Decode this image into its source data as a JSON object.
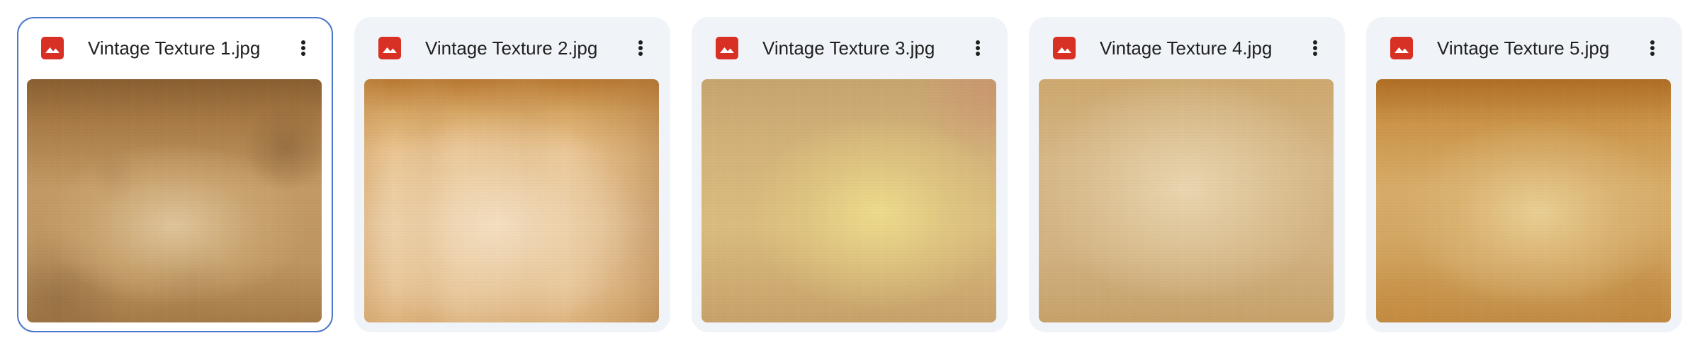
{
  "files": [
    {
      "name": "Vintage Texture 1.jpg",
      "type_icon": "image-file-icon",
      "selected": true
    },
    {
      "name": "Vintage Texture 2.jpg",
      "type_icon": "image-file-icon",
      "selected": false
    },
    {
      "name": "Vintage Texture 3.jpg",
      "type_icon": "image-file-icon",
      "selected": false
    },
    {
      "name": "Vintage Texture 4.jpg",
      "type_icon": "image-file-icon",
      "selected": false
    },
    {
      "name": "Vintage Texture 5.jpg",
      "type_icon": "image-file-icon",
      "selected": false
    }
  ],
  "colors": {
    "card_background": "#f0f4f9",
    "selected_border": "#4a78c9",
    "image_icon": "#d93025",
    "text": "#1f1f1f"
  }
}
